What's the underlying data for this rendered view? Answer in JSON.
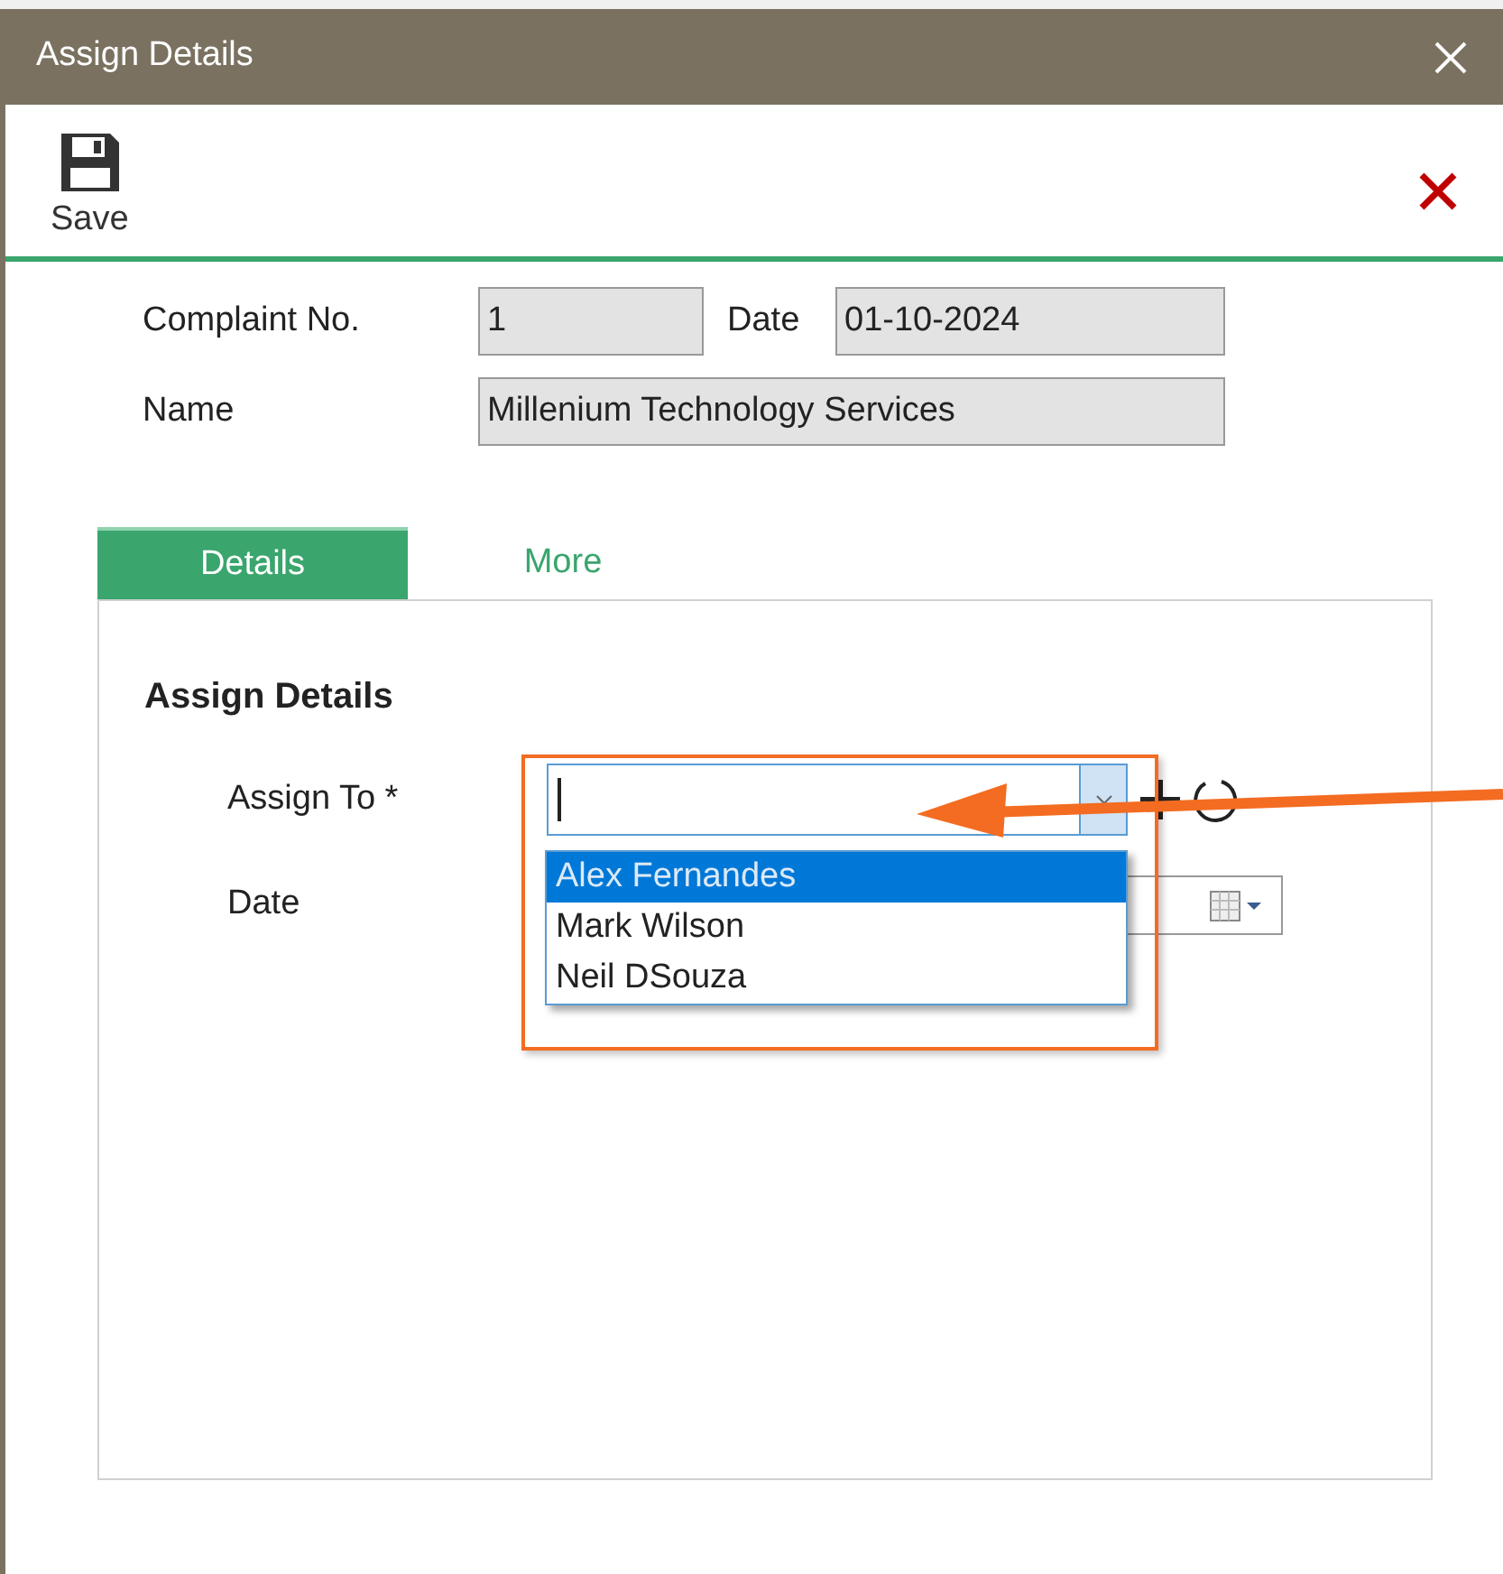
{
  "window": {
    "title": "Assign Details"
  },
  "toolbar": {
    "save_label": "Save"
  },
  "header": {
    "complaint_label": "Complaint No.",
    "complaint_value": "1",
    "date_label": "Date",
    "date_value": "01-10-2024",
    "name_label": "Name",
    "name_value": "Millenium Technology Services"
  },
  "tabs": [
    {
      "label": "Details",
      "selected": true
    },
    {
      "label": "More",
      "selected": false
    }
  ],
  "section": {
    "title": "Assign Details",
    "assign_label": "Assign To *",
    "date_label": "Date"
  },
  "dropdown": {
    "options": [
      {
        "label": "Alex Fernandes",
        "selected": true
      },
      {
        "label": "Mark Wilson",
        "selected": false
      },
      {
        "label": "Neil DSouza",
        "selected": false
      }
    ]
  }
}
